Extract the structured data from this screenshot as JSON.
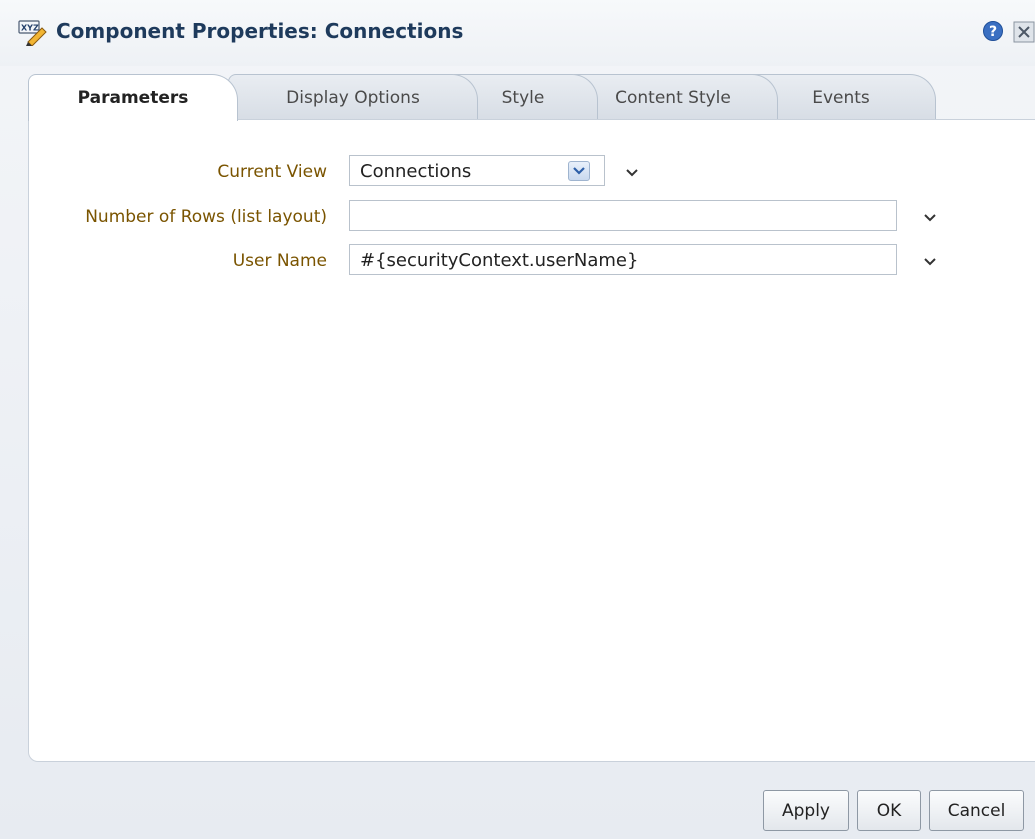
{
  "dialog": {
    "title": "Component Properties: Connections",
    "title_icon": "xyz-pencil-icon"
  },
  "tabs": [
    {
      "label": "Parameters",
      "active": true
    },
    {
      "label": "Display Options",
      "active": false
    },
    {
      "label": "Style",
      "active": false
    },
    {
      "label": "Content Style",
      "active": false
    },
    {
      "label": "Events",
      "active": false
    }
  ],
  "form": {
    "current_view": {
      "label": "Current View",
      "value": "Connections"
    },
    "rows": {
      "label": "Number of Rows (list layout)",
      "value": ""
    },
    "user_name": {
      "label": "User Name",
      "value": "#{securityContext.userName}"
    }
  },
  "buttons": {
    "apply": "Apply",
    "ok": "OK",
    "cancel": "Cancel"
  },
  "colors": {
    "title": "#1e3a5c",
    "label": "#7a5400",
    "accent": "#3b6fb6"
  }
}
